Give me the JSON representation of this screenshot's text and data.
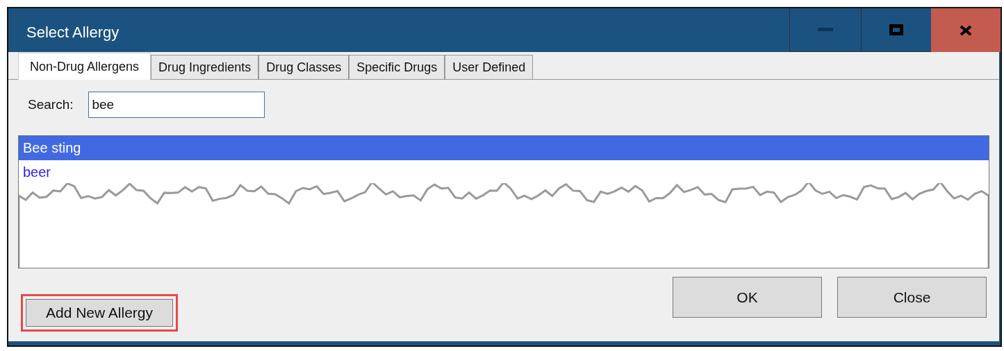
{
  "window": {
    "title": "Select Allergy"
  },
  "tabs": [
    {
      "label": "Non-Drug Allergens",
      "selected": true
    },
    {
      "label": "Drug Ingredients",
      "selected": false
    },
    {
      "label": "Drug Classes",
      "selected": false
    },
    {
      "label": "Specific Drugs",
      "selected": false
    },
    {
      "label": "User Defined",
      "selected": false
    }
  ],
  "search": {
    "label": "Search:",
    "value": "bee"
  },
  "results": [
    {
      "label": "Bee sting",
      "selected": true
    },
    {
      "label": "beer",
      "selected": false
    }
  ],
  "buttons": [
    {
      "label": "Add New Allergy",
      "highlighted": true
    },
    {
      "label": "OK",
      "highlighted": false
    },
    {
      "label": "Close",
      "highlighted": false
    }
  ]
}
